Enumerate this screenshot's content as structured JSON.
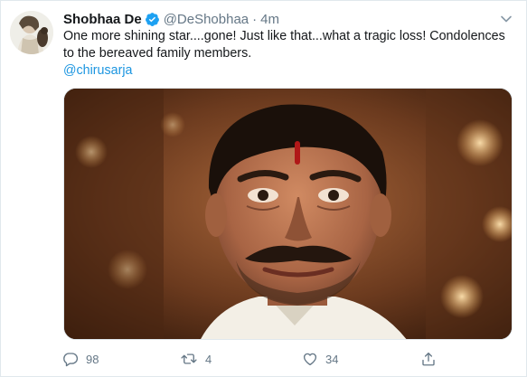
{
  "tweet": {
    "author": {
      "name": "Shobhaa De",
      "handle": "@DeShobhaa",
      "verified": true,
      "avatar_icon": "profile-photo"
    },
    "separator": "·",
    "time": "4m",
    "text_line": "One more shining star....gone! Just like that...what a tragic loss! Condolences to the bereaved family members.",
    "mention": "@chirusarja",
    "media": {
      "description_icon": "portrait-photo"
    },
    "actions": {
      "reply": {
        "icon": "reply-icon",
        "count": "98"
      },
      "retweet": {
        "icon": "retweet-icon",
        "count": "4"
      },
      "like": {
        "icon": "heart-icon",
        "count": "34"
      },
      "share": {
        "icon": "share-icon"
      }
    },
    "menu_icon": "chevron-down-icon"
  },
  "colors": {
    "text": "#14171a",
    "secondary": "#657786",
    "link": "#1b95e0",
    "verified": "#1da1f2",
    "border": "#e1e8ed"
  }
}
